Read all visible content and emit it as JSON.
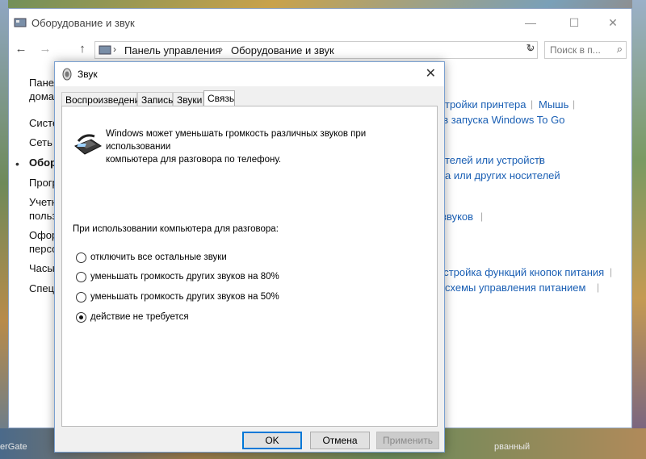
{
  "desktop": {
    "bottom_left_label": "erGate",
    "bottom_right_label": "рванный"
  },
  "cp_window": {
    "title": "Оборудование и звук",
    "buttons": {
      "minimize": "—",
      "maximize": "☐",
      "close": "✕"
    },
    "nav": {
      "back": "←",
      "forward": "→",
      "up": "↑"
    },
    "address": {
      "sep1": "›",
      "crumb1": "Панель управления",
      "sep2": "›",
      "crumb2": "Оборудование и звук",
      "dropdown": "⌄",
      "refresh": "↻"
    },
    "search": {
      "placeholder": "Поиск в п...",
      "icon": "⌕"
    },
    "left_items": [
      "Панел",
      "домаш",
      "Систе",
      "Сеть и",
      "Обору",
      "Прогр",
      "Учетн",
      "польз",
      "Офор",
      "персо",
      "Часы,",
      "Специ"
    ],
    "left_bullet": "•",
    "right_links": {
      "printer_settings": "тройки принтера",
      "mouse": "Мышь",
      "windows_to_go": "ов запуска Windows To Go",
      "devices": "телей или устройств",
      "media": "ка или других носителей",
      "sounds": "звуков",
      "power_buttons": "астройка функций кнопок питания",
      "power_plan": "схемы управления питанием"
    }
  },
  "dialog": {
    "title": "Звук",
    "close": "✕",
    "tabs": [
      "Воспроизведение",
      "Запись",
      "Звуки",
      "Связь"
    ],
    "active_tab": "Связь",
    "intro_line1": "Windows может уменьшать громкость различных звуков при использовании",
    "intro_line2": "компьютера для разговора по телефону.",
    "question": "При использовании компьютера для разговора:",
    "options": [
      {
        "label": "отключить все остальные звуки",
        "selected": false
      },
      {
        "label": "уменьшать громкость других звуков на 80%",
        "selected": false
      },
      {
        "label": "уменьшать громкость других звуков на 50%",
        "selected": false
      },
      {
        "label": "действие не требуется",
        "selected": true
      }
    ],
    "buttons": {
      "ok": "OK",
      "cancel": "Отмена",
      "apply": "Применить"
    }
  }
}
